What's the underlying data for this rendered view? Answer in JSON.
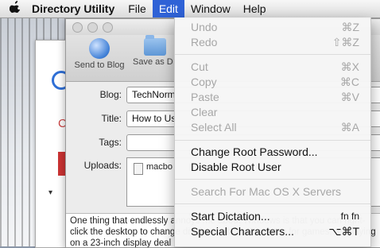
{
  "menubar": {
    "apple": "",
    "app_name": "Directory Utility",
    "menus": [
      "File",
      "Edit",
      "Window",
      "Help"
    ]
  },
  "toolbar": {
    "send_to_blog": "Send to Blog",
    "save_as": "Save as D"
  },
  "form": {
    "blog_label": "Blog:",
    "blog_value": "TechNorm",
    "title_label": "Title:",
    "title_value": "How to Us",
    "tags_label": "Tags:",
    "tags_value": "",
    "uploads_label": "Uploads:",
    "upload_file": "macbo"
  },
  "body_text": "One thing that endlessly annoys me about Windows is that you can right-click the desktop to change display. I prefer this setup for games, as playing on a 23-inch display deal",
  "background_window": {
    "c_text": "C"
  },
  "edit_menu": {
    "items": [
      {
        "label": "Undo",
        "shortcut": "⌘Z"
      },
      {
        "label": "Redo",
        "shortcut": "⇧⌘Z"
      },
      {
        "label": "Cut",
        "shortcut": "⌘X"
      },
      {
        "label": "Copy",
        "shortcut": "⌘C"
      },
      {
        "label": "Paste",
        "shortcut": "⌘V"
      },
      {
        "label": "Clear",
        "shortcut": ""
      },
      {
        "label": "Select All",
        "shortcut": "⌘A"
      },
      {
        "label": "Change Root Password...",
        "shortcut": ""
      },
      {
        "label": "Disable Root User",
        "shortcut": ""
      },
      {
        "label": "Search For Mac OS X Servers",
        "shortcut": ""
      },
      {
        "label": "Start Dictation...",
        "shortcut": "fn fn"
      },
      {
        "label": "Special Characters...",
        "shortcut": "⌥⌘T"
      }
    ]
  }
}
